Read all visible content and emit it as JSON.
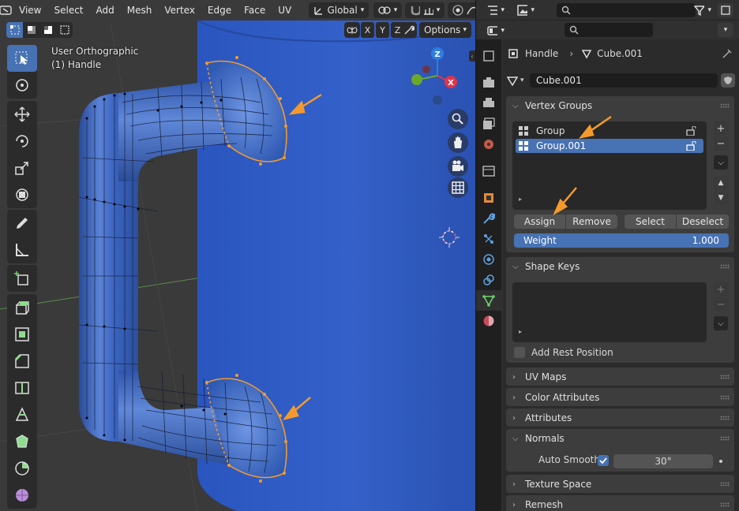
{
  "viewport": {
    "menu": [
      "View",
      "Select",
      "Add",
      "Mesh",
      "Vertex",
      "Edge",
      "Face",
      "UV"
    ],
    "transform_orientation": "Global",
    "axis_buttons": [
      "X",
      "Y",
      "Z"
    ],
    "options_label": "Options",
    "view_name": "User Orthographic",
    "object_info": "(1) Handle",
    "gizmo_axes": {
      "z": "Z",
      "x": "X"
    },
    "tools": [
      "select-box",
      "cursor",
      "move",
      "rotate",
      "scale",
      "transform",
      "annotate",
      "measure",
      "add-cube",
      "extrude",
      "inset",
      "bevel",
      "loop-cut",
      "knife",
      "poly-build",
      "spin",
      "smooth"
    ]
  },
  "properties": {
    "breadcrumb": {
      "object": "Handle",
      "mesh": "Cube.001"
    },
    "mesh_name": "Cube.001",
    "vertex_groups": {
      "title": "Vertex Groups",
      "items": [
        {
          "name": "Group",
          "selected": false
        },
        {
          "name": "Group.001",
          "selected": true
        }
      ],
      "buttons": {
        "assign": "Assign",
        "remove": "Remove",
        "select": "Select",
        "deselect": "Deselect"
      },
      "weight_label": "Weight",
      "weight_value": "1.000"
    },
    "shape_keys": {
      "title": "Shape Keys",
      "add_rest_position": "Add Rest Position",
      "add_rest_checked": false
    },
    "collapsed_panels": [
      "UV Maps",
      "Color Attributes",
      "Attributes"
    ],
    "normals": {
      "title": "Normals",
      "auto_smooth_label": "Auto Smooth",
      "auto_smooth_checked": true,
      "angle": "30°"
    },
    "bottom_panels": [
      "Texture Space",
      "Remesh"
    ]
  },
  "colors": {
    "accent": "#4772b3",
    "selection_orange": "#f39a2d",
    "mesh_face": "#3c64b4",
    "background_mesh": "#2f5bc2"
  }
}
